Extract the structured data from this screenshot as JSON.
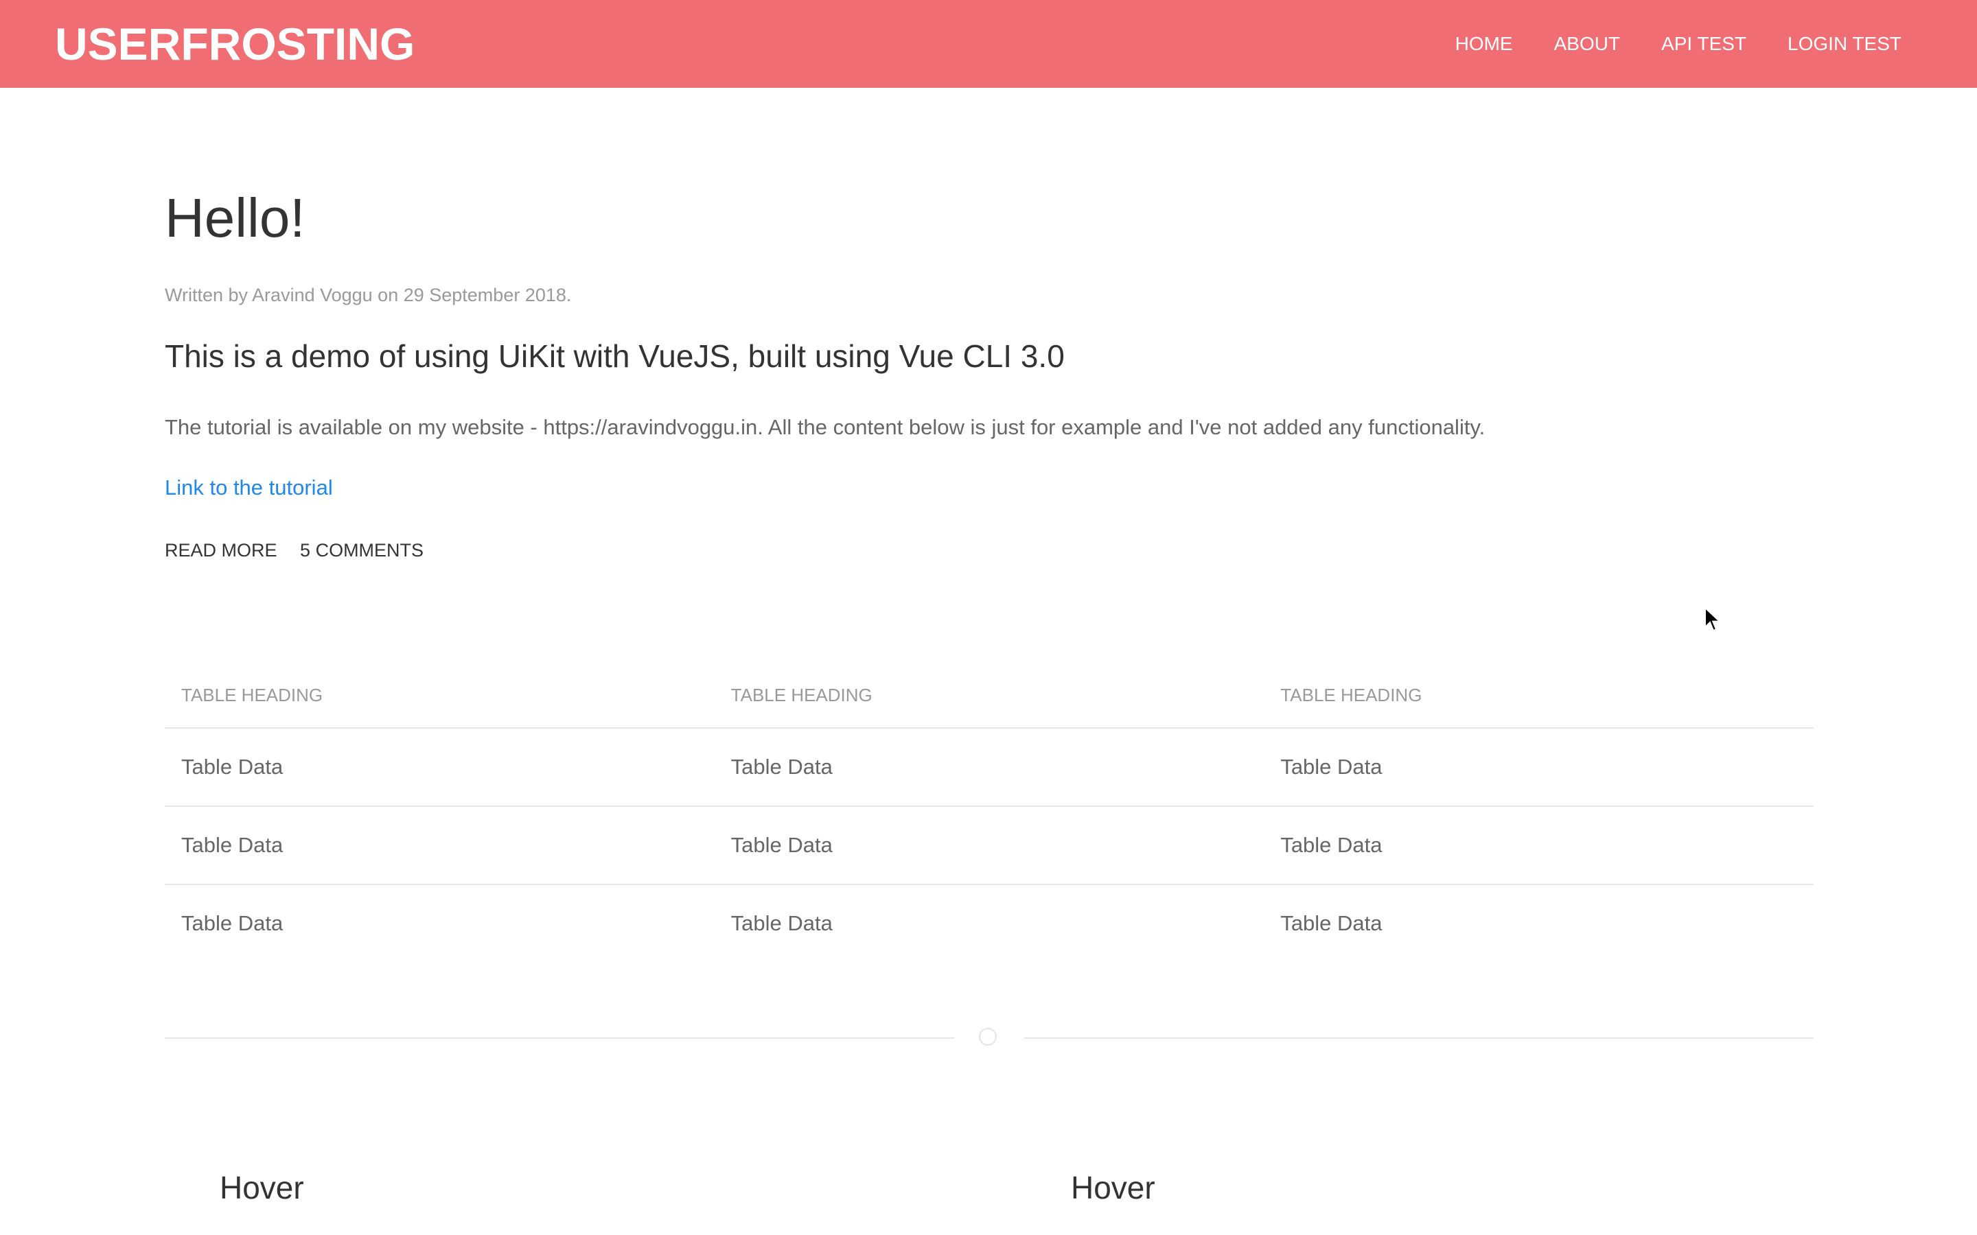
{
  "header": {
    "logo": "USERFROSTING",
    "nav": [
      "HOME",
      "ABOUT",
      "API TEST",
      "LOGIN TEST"
    ]
  },
  "article": {
    "title": "Hello!",
    "meta": "Written by Aravind Voggu on 29 September 2018.",
    "lead": "This is a demo of using UiKit with VueJS, built using Vue CLI 3.0",
    "body": "The tutorial is available on my website - https://aravindvoggu.in. All the content below is just for example and I've not added any functionality.",
    "link": "Link to the tutorial",
    "actions": [
      "READ MORE",
      "5 COMMENTS"
    ]
  },
  "table": {
    "headers": [
      "TABLE HEADING",
      "TABLE HEADING",
      "TABLE HEADING"
    ],
    "rows": [
      [
        "Table Data",
        "Table Data",
        "Table Data"
      ],
      [
        "Table Data",
        "Table Data",
        "Table Data"
      ],
      [
        "Table Data",
        "Table Data",
        "Table Data"
      ]
    ]
  },
  "cards": [
    {
      "title": "Hover"
    },
    {
      "title": "Hover"
    }
  ],
  "colors": {
    "navbar": "#f06e73",
    "link": "#1e87f0"
  }
}
